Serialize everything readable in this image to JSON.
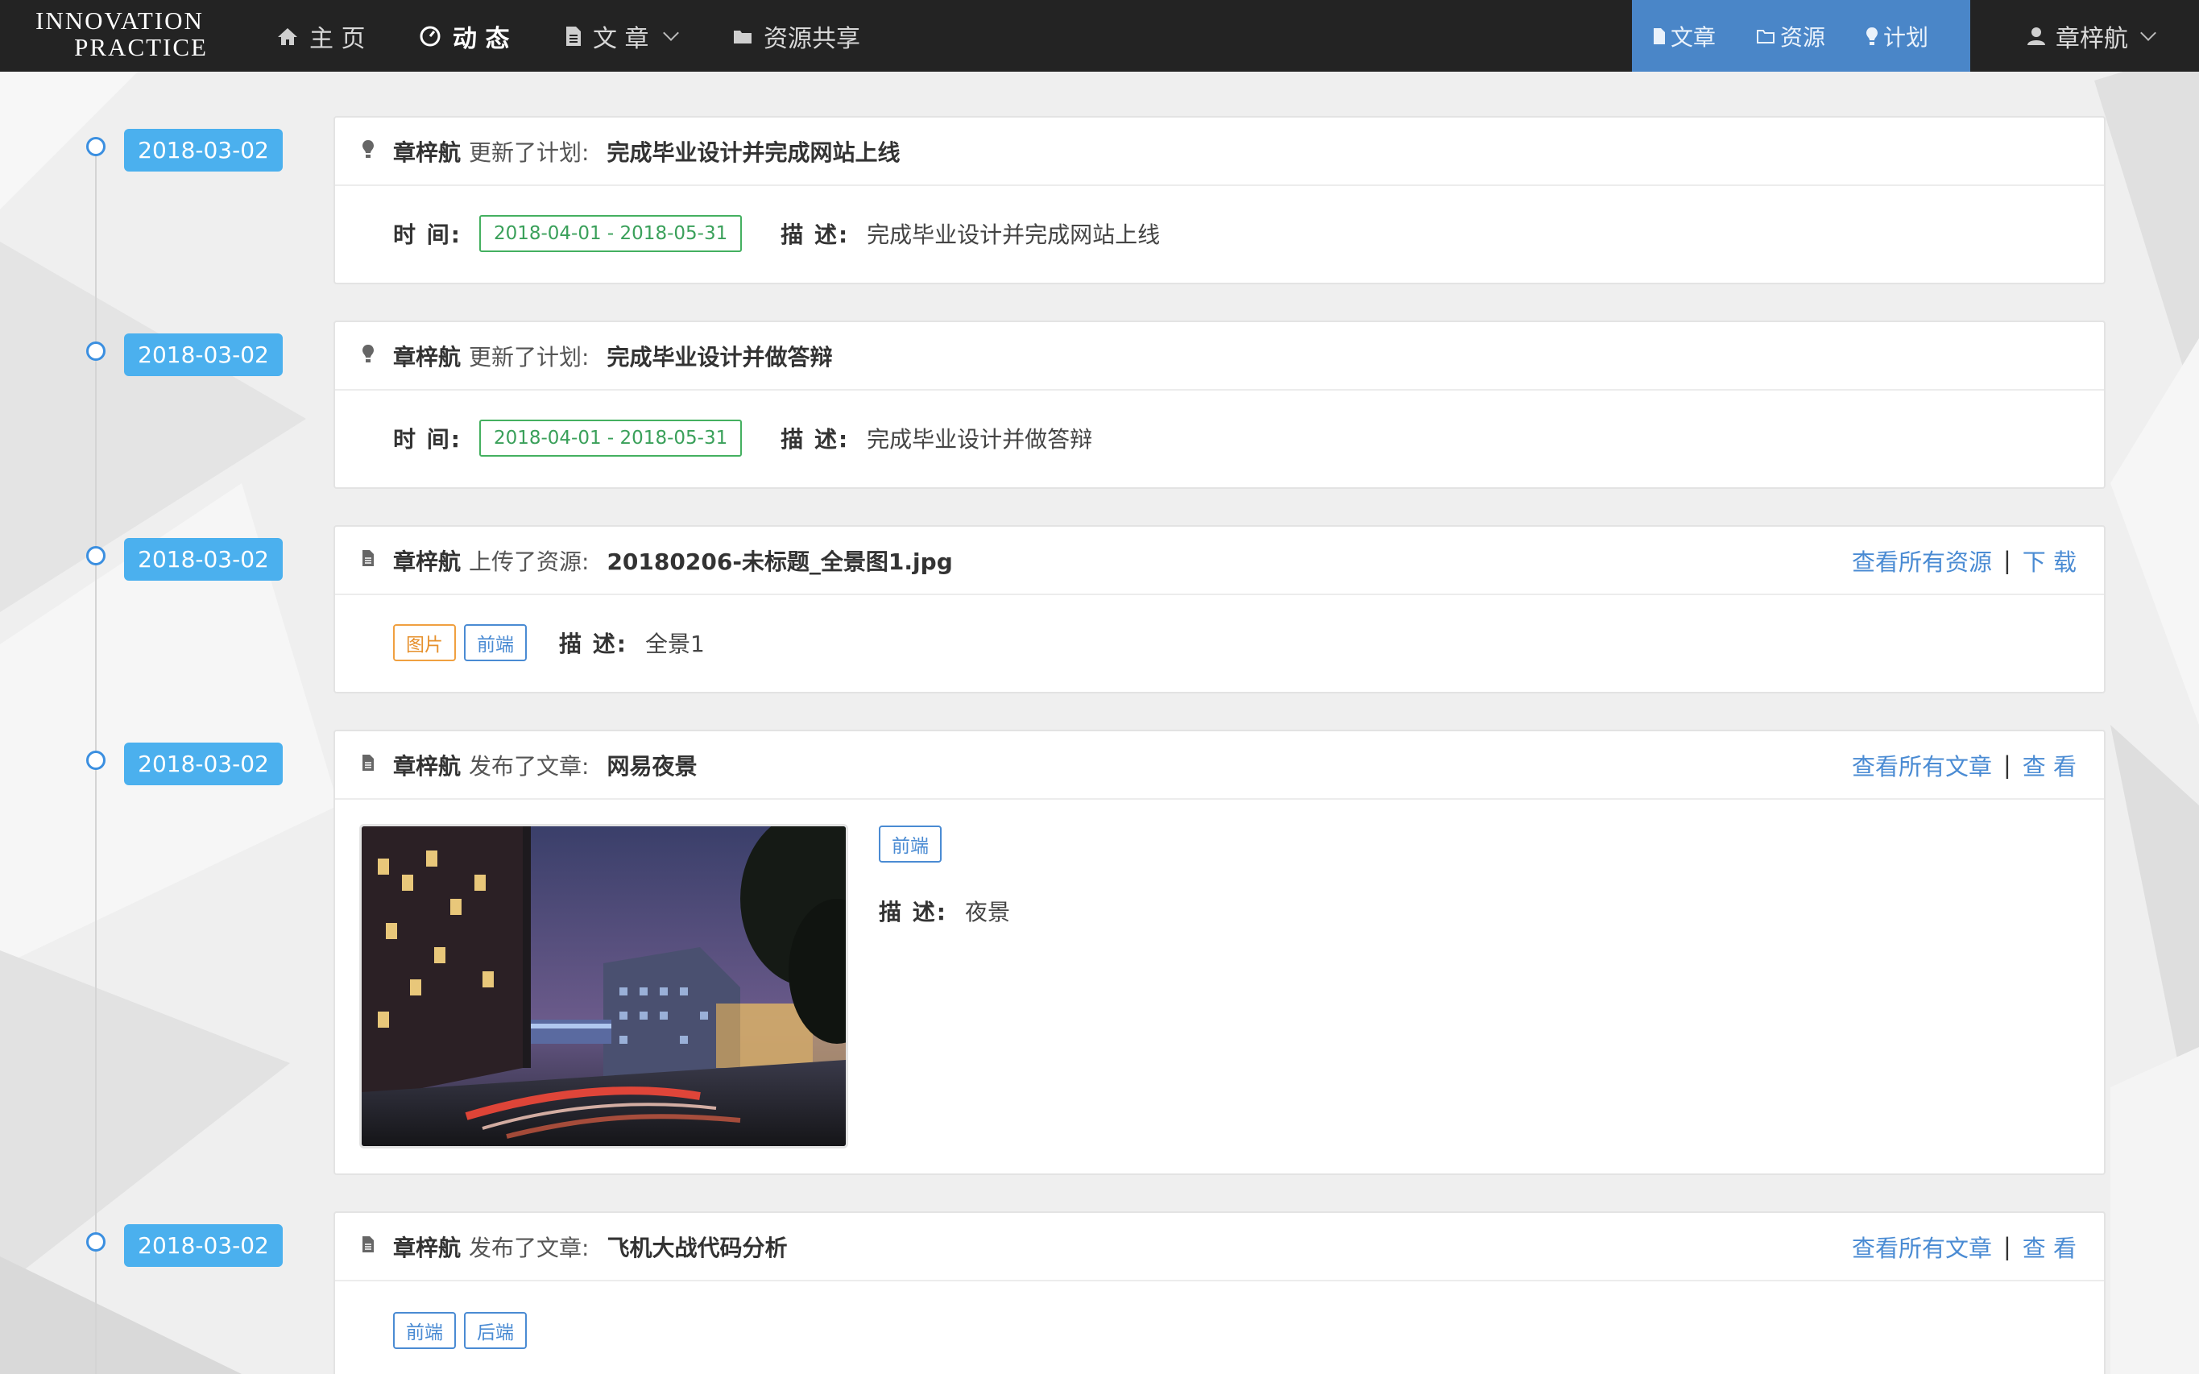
{
  "nav": {
    "logo_line1": "INNOVATION",
    "logo_line2": "PRACTICE",
    "home": "主 页",
    "activity": "动 态",
    "articles": "文 章",
    "resources": "资源共享",
    "quick_article": "文章",
    "quick_resource": "资源",
    "quick_plan": "计划",
    "user": "章梓航"
  },
  "colors": {
    "navbar_bg": "#232323",
    "quick_bg": "#4a86c8",
    "date_badge": "#4bb0ee",
    "link": "#4a8bd3",
    "time_tag": "#44b060",
    "image_tag": "#f0a040"
  },
  "labels": {
    "time": "时 间:",
    "desc": "描 述:"
  },
  "feed": [
    {
      "date": "2018-03-02",
      "icon": "lightbulb-icon",
      "author": "章梓航",
      "action": "更新了计划:",
      "title": "完成毕业设计并完成网站上线",
      "time_range": "2018-04-01 - 2018-05-31",
      "desc": "完成毕业设计并完成网站上线"
    },
    {
      "date": "2018-03-02",
      "icon": "lightbulb-icon",
      "author": "章梓航",
      "action": "更新了计划:",
      "title": "完成毕业设计并做答辩",
      "time_range": "2018-04-01 - 2018-05-31",
      "desc": "完成毕业设计并做答辩"
    },
    {
      "date": "2018-03-02",
      "icon": "file-icon",
      "author": "章梓航",
      "action": "上传了资源:",
      "title": "20180206-未标题_全景图1.jpg",
      "link_all": "查看所有资源",
      "link_action": "下 载",
      "tags": [
        "图片",
        "前端"
      ],
      "desc": "全景1"
    },
    {
      "date": "2018-03-02",
      "icon": "file-icon",
      "author": "章梓航",
      "action": "发布了文章:",
      "title": "网易夜景",
      "link_all": "查看所有文章",
      "link_action": "查 看",
      "tags": [
        "前端"
      ],
      "desc": "夜景"
    },
    {
      "date": "2018-03-02",
      "icon": "file-icon",
      "author": "章梓航",
      "action": "发布了文章:",
      "title": "飞机大战代码分析",
      "link_all": "查看所有文章",
      "link_action": "查 看",
      "tags": [
        "前端",
        "后端"
      ]
    }
  ]
}
